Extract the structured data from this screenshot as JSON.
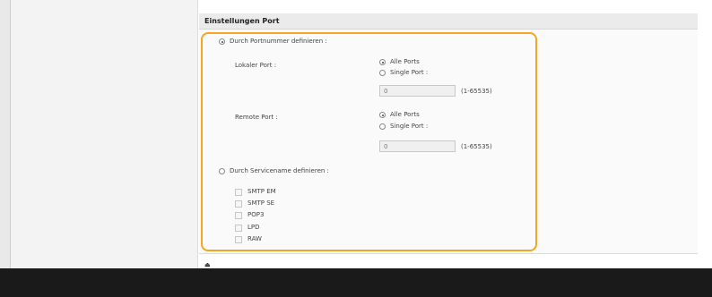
{
  "section": {
    "title": "Einstellungen Port"
  },
  "port_definition": {
    "label": "Durch Portnummer definieren :",
    "selected": true
  },
  "local_port": {
    "label": "Lokaler Port :",
    "options": [
      "Alle Ports",
      "Single Port :"
    ],
    "selected": "Alle Ports",
    "value": "0",
    "range": "(1-65535)"
  },
  "remote_port": {
    "label": "Remote Port :",
    "options": [
      "Alle Ports",
      "Single Port :"
    ],
    "selected": "Alle Ports",
    "value": "0",
    "range": "(1-65535)"
  },
  "service_definition": {
    "label": "Durch Servicename definieren :",
    "selected": false,
    "services": [
      "SMTP EM",
      "SMTP SE",
      "POP3",
      "LPD",
      "RAW"
    ]
  },
  "footer": {
    "top_link_icon": "scroll-to-top-icon",
    "top_link_glyph": "⏏"
  },
  "colors": {
    "highlight": "#f5a623",
    "bottom_bar": "#1a1a1a"
  }
}
